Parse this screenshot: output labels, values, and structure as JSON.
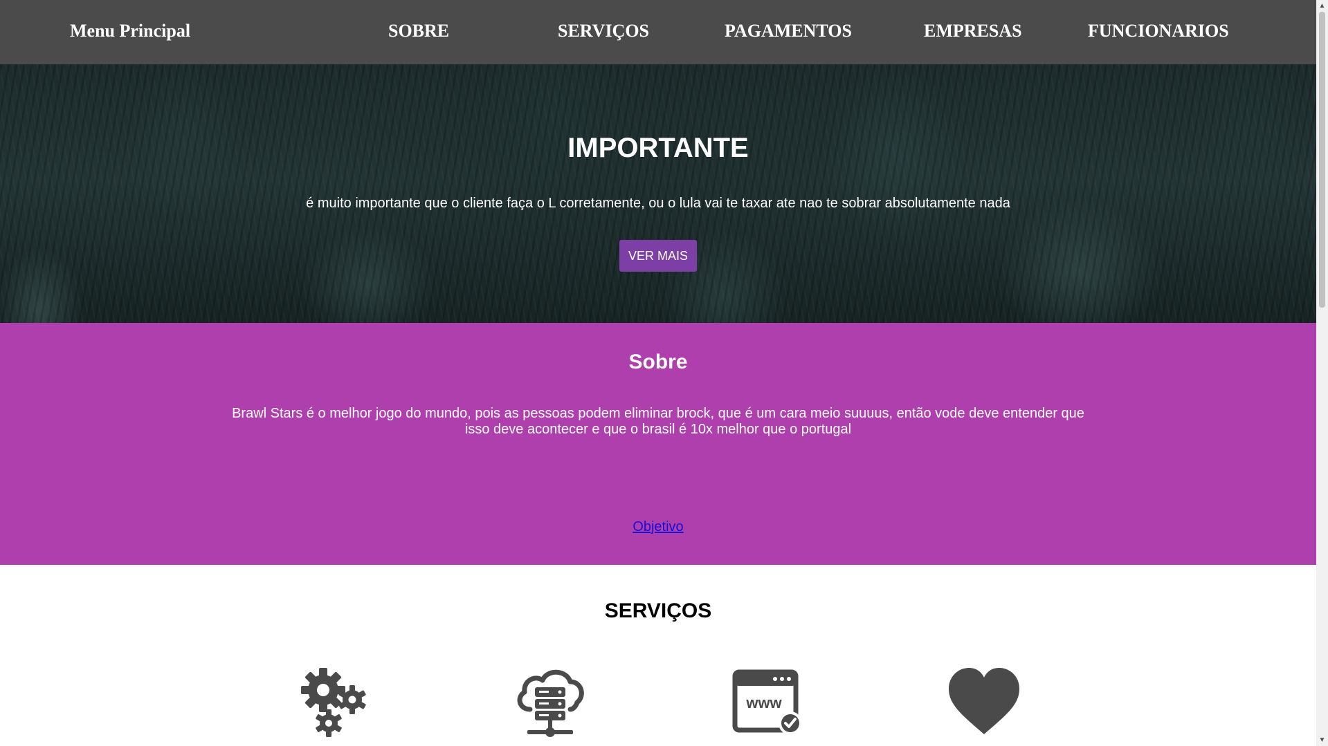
{
  "nav": {
    "brand": "Menu Principal",
    "links": [
      "SOBRE",
      "SERVIÇOS",
      "PAGAMENTOS",
      "EMPRESAS",
      "FUNCIONARIOS"
    ]
  },
  "hero": {
    "title": "IMPORTANTE",
    "text": "é muito importante que o cliente faça o L corretamente, ou o lula vai te taxar ate nao te sobrar absolutamente nada",
    "button_label": "VER MAIS"
  },
  "sobre": {
    "title": "Sobre",
    "text": "Brawl Stars é o melhor jogo do mundo, pois as pessoas podem eliminar brock, que é um cara meio suuuus, então vode deve entender que isso deve acontecer e que o brasil é 10x melhor que o portugal",
    "link_label": "Objetivo"
  },
  "servicos": {
    "title": "SERVIÇOS",
    "icons": [
      "gears-icon",
      "cloud-server-icon",
      "website-check-icon",
      "heart-icon"
    ]
  },
  "colors": {
    "nav_bg": "#4b4b4b",
    "accent_purple": "#b03fae",
    "button_purple": "#7d3ea6",
    "link_blue": "#1a0dd6",
    "icon_gray": "#4a4a4a"
  }
}
